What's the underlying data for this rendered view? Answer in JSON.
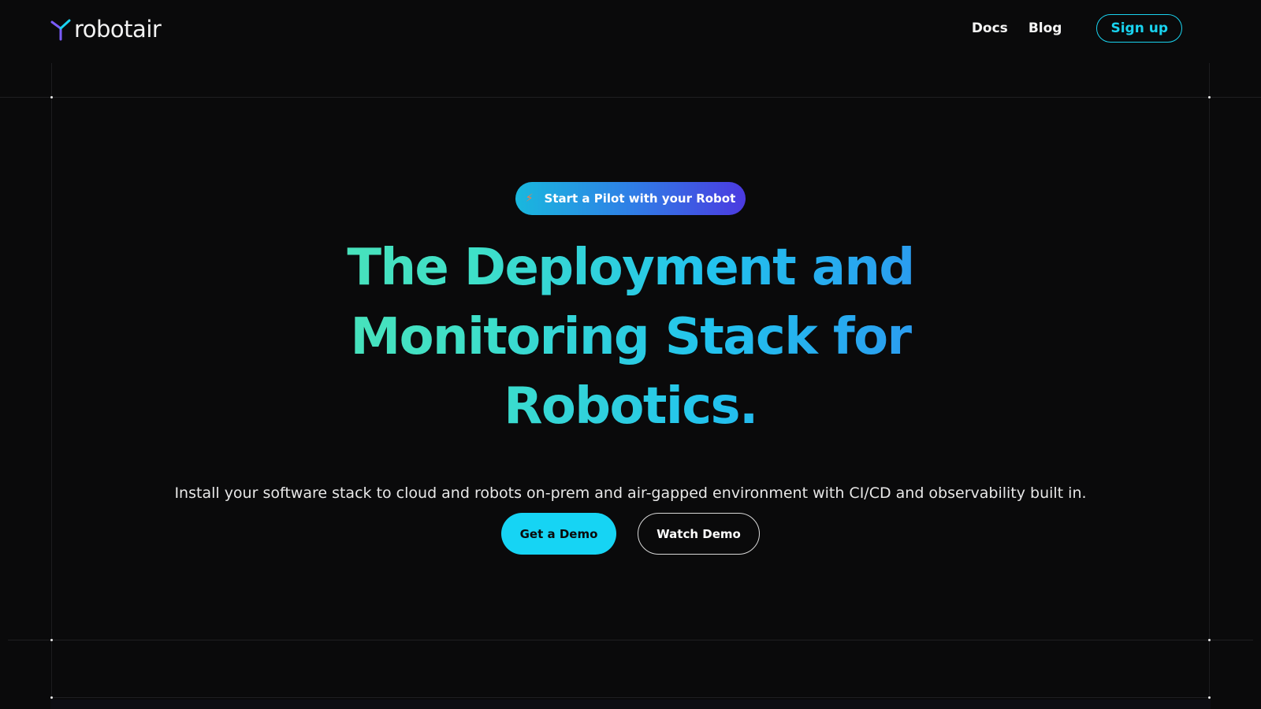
{
  "header": {
    "logo_text": "robotair",
    "nav": {
      "docs_label": "Docs",
      "blog_label": "Blog",
      "signup_label": "Sign up"
    }
  },
  "hero": {
    "pill_label": "Start a Pilot with your Robot",
    "pill_icon": "lightning-icon",
    "headline_lines": [
      "The Deployment and",
      "Monitoring Stack for",
      "Robotics."
    ],
    "subtitle": "Install your software stack to cloud and robots on-prem and air-gapped environment with CI/CD and observability built in.",
    "primary_button": "Get a Demo",
    "secondary_button": "Watch Demo"
  },
  "colors": {
    "background": "#0a0a0b",
    "accent": "#16d4f4",
    "headline_gradient_start": "#4fe3b0",
    "headline_gradient_end": "#2f86f0",
    "pill_gradient_start": "#19b8de",
    "pill_gradient_end": "#4b3ae0"
  }
}
